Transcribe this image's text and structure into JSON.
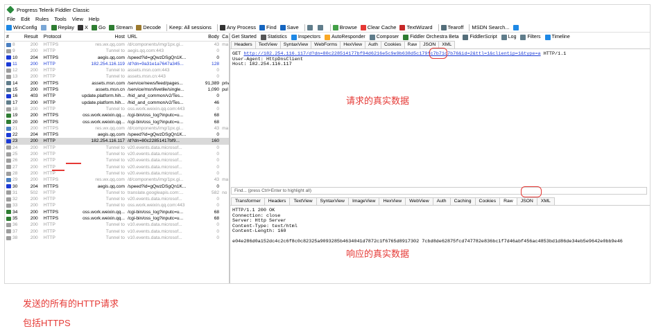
{
  "window": {
    "title": "Progress Telerik Fiddler Classic"
  },
  "menu": [
    "File",
    "Edit",
    "Rules",
    "Tools",
    "View",
    "Help"
  ],
  "toolbar": {
    "items": [
      {
        "label": "WinConfig",
        "icon": "windows-icon",
        "color": "#1e88e5"
      },
      {
        "label": "",
        "icon": "comment-icon",
        "color": "#7aa7d6"
      },
      {
        "label": "Replay",
        "icon": "replay-icon",
        "color": "#2e7d32"
      },
      {
        "label": "X",
        "icon": "remove-icon",
        "color": "#333333"
      },
      {
        "label": "Go",
        "icon": "go-icon",
        "color": "#2e7d32"
      },
      {
        "label": "Stream",
        "icon": "stream-icon",
        "color": "#2e7d32"
      },
      {
        "label": "Decode",
        "icon": "decode-icon",
        "color": "#9c7a2e"
      },
      {
        "label": "Keep: All sessions",
        "icon": "",
        "color": ""
      },
      {
        "label": "Any Process",
        "icon": "crosshair-icon",
        "color": "#333333"
      },
      {
        "label": "Find",
        "icon": "find-icon",
        "color": "#1565c0"
      },
      {
        "label": "Save",
        "icon": "save-icon",
        "color": "#1565c0"
      },
      {
        "label": "",
        "icon": "snapshot-icon",
        "color": "#607d8b"
      },
      {
        "label": "",
        "icon": "timer-icon",
        "color": "#607d8b"
      },
      {
        "label": "Browse",
        "icon": "browse-icon",
        "color": "#43a047"
      },
      {
        "label": "Clear Cache",
        "icon": "clear-cache-icon",
        "color": "#e53935"
      },
      {
        "label": "TextWizard",
        "icon": "textwizard-icon",
        "color": "#c62828"
      },
      {
        "label": "Tearoff",
        "icon": "tearoff-icon",
        "color": "#546e7a"
      },
      {
        "label": "MSDN Search...",
        "icon": "",
        "color": ""
      },
      {
        "label": "",
        "icon": "help-icon",
        "color": "#1e88e5"
      }
    ]
  },
  "sessions": {
    "columns": [
      "#",
      "Result",
      "Protocol",
      "Host",
      "URL",
      "Body",
      "Ca"
    ],
    "rows": [
      {
        "id": "8",
        "result": "200",
        "protocol": "HTTPS",
        "host": "res.wx.qq.com",
        "url": "/d/components/img/1px.gi...",
        "body": "43",
        "ca": "ma",
        "style": "grey",
        "icon": "image-icon",
        "iconColor": "#4a7fc1"
      },
      {
        "id": "9",
        "result": "200",
        "protocol": "HTTP",
        "host": "Tunnel to",
        "url": "aegis.qq.com:443",
        "body": "0",
        "ca": "",
        "style": "grey",
        "icon": "lock-icon",
        "iconColor": "#9e9e9e"
      },
      {
        "id": "10",
        "result": "204",
        "protocol": "HTTPS",
        "host": "aegis.qq.com",
        "url": "/speed?id=gQwzDSgQn1K...",
        "body": "0",
        "ca": "",
        "style": "normal",
        "icon": "info-icon",
        "iconColor": "#1a3ad6"
      },
      {
        "id": "11",
        "result": "200",
        "protocol": "HTTP",
        "host": "182.254.116.119",
        "url": "/d?dn=9a31e1a7647a345...",
        "body": "128",
        "ca": "",
        "style": "blue",
        "icon": "arrows-icon",
        "iconColor": "#1a3ad6"
      },
      {
        "id": "12",
        "result": "200",
        "protocol": "HTTP",
        "host": "Tunnel to",
        "url": "assets.msn.com:443",
        "body": "0",
        "ca": "",
        "style": "grey",
        "icon": "lock-icon",
        "iconColor": "#9e9e9e"
      },
      {
        "id": "13",
        "result": "200",
        "protocol": "HTTP",
        "host": "Tunnel to",
        "url": "assets.msn.cn:443",
        "body": "0",
        "ca": "",
        "style": "grey",
        "icon": "lock-icon",
        "iconColor": "#9e9e9e"
      },
      {
        "id": "14",
        "result": "200",
        "protocol": "HTTPS",
        "host": "assets.msn.com",
        "url": "/service/news/feed/pages...",
        "body": "91,389",
        "ca": "priv",
        "style": "normal",
        "icon": "json-icon",
        "iconColor": "#607d8b"
      },
      {
        "id": "15",
        "result": "200",
        "protocol": "HTTPS",
        "host": "assets.msn.cn",
        "url": "/service/msn/livetile/single...",
        "body": "1,090",
        "ca": "pul",
        "style": "normal",
        "icon": "doc-icon",
        "iconColor": "#607d8b"
      },
      {
        "id": "16",
        "result": "403",
        "protocol": "HTTP",
        "host": "update.platform.hih...",
        "url": "/hid_and_common/v2/Tes...",
        "body": "0",
        "ca": "",
        "style": "normal",
        "icon": "warning-icon",
        "iconColor": "#1a3ad6"
      },
      {
        "id": "17",
        "result": "200",
        "protocol": "HTTP",
        "host": "update.platform.hih...",
        "url": "/hid_and_common/v2/Tes...",
        "body": "46",
        "ca": "",
        "style": "normal",
        "icon": "json-icon",
        "iconColor": "#607d8b"
      },
      {
        "id": "18",
        "result": "200",
        "protocol": "HTTP",
        "host": "Tunnel to",
        "url": "oss.work.weixin.qq.com:443",
        "body": "0",
        "ca": "",
        "style": "grey",
        "icon": "lock-icon",
        "iconColor": "#9e9e9e"
      },
      {
        "id": "19",
        "result": "200",
        "protocol": "HTTPS",
        "host": "oss.work.weixin.qq...",
        "url": "/cgi-bin/oss_log?inputc=u...",
        "body": "68",
        "ca": "",
        "style": "normal",
        "icon": "script-icon",
        "iconColor": "#2e7d32"
      },
      {
        "id": "20",
        "result": "200",
        "protocol": "HTTPS",
        "host": "oss.work.weixin.qq...",
        "url": "/cgi-bin/oss_log?inputc=u...",
        "body": "68",
        "ca": "",
        "style": "normal",
        "icon": "script-icon",
        "iconColor": "#2e7d32"
      },
      {
        "id": "21",
        "result": "200",
        "protocol": "HTTPS",
        "host": "res.wx.qq.com",
        "url": "/d/components/img/1px.gi...",
        "body": "43",
        "ca": "ma",
        "style": "grey",
        "icon": "image-icon",
        "iconColor": "#4a7fc1"
      },
      {
        "id": "22",
        "result": "204",
        "protocol": "HTTPS",
        "host": "aegis.qq.com",
        "url": "/speed?id=gQwzDSgQn1K...",
        "body": "0",
        "ca": "",
        "style": "normal",
        "icon": "info-icon",
        "iconColor": "#1a3ad6"
      },
      {
        "id": "23",
        "result": "200",
        "protocol": "HTTP",
        "host": "182.254.116.117",
        "url": "/d?dn=80c22851417bf9...",
        "body": "160",
        "ca": "",
        "style": "sel",
        "icon": "arrows-icon",
        "iconColor": "#1a3ad6"
      },
      {
        "id": "24",
        "result": "200",
        "protocol": "HTTP",
        "host": "Tunnel to",
        "url": "v20.events.data.microsof...",
        "body": "0",
        "ca": "",
        "style": "grey",
        "icon": "lock-icon",
        "iconColor": "#9e9e9e"
      },
      {
        "id": "25",
        "result": "200",
        "protocol": "HTTP",
        "host": "Tunnel to",
        "url": "v20.events.data.microsof...",
        "body": "0",
        "ca": "",
        "style": "grey",
        "icon": "lock-icon",
        "iconColor": "#9e9e9e"
      },
      {
        "id": "26",
        "result": "200",
        "protocol": "HTTP",
        "host": "Tunnel to",
        "url": "v20.events.data.microsof...",
        "body": "0",
        "ca": "",
        "style": "grey",
        "icon": "lock-icon",
        "iconColor": "#9e9e9e"
      },
      {
        "id": "27",
        "result": "200",
        "protocol": "HTTP",
        "host": "Tunnel to",
        "url": "v20.events.data.microsof...",
        "body": "0",
        "ca": "",
        "style": "grey",
        "icon": "lock-icon",
        "iconColor": "#9e9e9e"
      },
      {
        "id": "28",
        "result": "200",
        "protocol": "HTTP",
        "host": "Tunnel to",
        "url": "v20.events.data.microsof...",
        "body": "0",
        "ca": "",
        "style": "grey",
        "icon": "lock-icon",
        "iconColor": "#9e9e9e"
      },
      {
        "id": "29",
        "result": "200",
        "protocol": "HTTPS",
        "host": "res.wx.qq.com",
        "url": "/d/components/img/1px.gi...",
        "body": "43",
        "ca": "ma",
        "style": "grey",
        "icon": "image-icon",
        "iconColor": "#4a7fc1"
      },
      {
        "id": "30",
        "result": "204",
        "protocol": "HTTPS",
        "host": "aegis.qq.com",
        "url": "/speed?id=gQwzDSgQn1K...",
        "body": "0",
        "ca": "",
        "style": "normal",
        "icon": "info-icon",
        "iconColor": "#1a3ad6"
      },
      {
        "id": "31",
        "result": "502",
        "protocol": "HTTP",
        "host": "Tunnel to",
        "url": "translate.googleapis.com:...",
        "body": "582",
        "ca": "no",
        "style": "grey",
        "icon": "lock-icon",
        "iconColor": "#9e9e9e"
      },
      {
        "id": "32",
        "result": "200",
        "protocol": "HTTP",
        "host": "Tunnel to",
        "url": "v20.events.data.microsof...",
        "body": "0",
        "ca": "",
        "style": "grey",
        "icon": "lock-icon",
        "iconColor": "#9e9e9e"
      },
      {
        "id": "33",
        "result": "200",
        "protocol": "HTTP",
        "host": "Tunnel to",
        "url": "oss.work.weixin.qq.com:443",
        "body": "0",
        "ca": "",
        "style": "grey",
        "icon": "lock-icon",
        "iconColor": "#9e9e9e"
      },
      {
        "id": "34",
        "result": "200",
        "protocol": "HTTPS",
        "host": "oss.work.weixin.qq...",
        "url": "/cgi-bin/oss_log?inputc=u...",
        "body": "68",
        "ca": "",
        "style": "normal",
        "icon": "script-icon",
        "iconColor": "#2e7d32"
      },
      {
        "id": "35",
        "result": "200",
        "protocol": "HTTPS",
        "host": "oss.work.weixin.qq...",
        "url": "/cgi-bin/oss_log?inputc=u...",
        "body": "68",
        "ca": "",
        "style": "normal",
        "icon": "script-icon",
        "iconColor": "#2e7d32"
      },
      {
        "id": "36",
        "result": "200",
        "protocol": "HTTP",
        "host": "Tunnel to",
        "url": "v10.events.data.microsof...",
        "body": "0",
        "ca": "",
        "style": "grey",
        "icon": "lock-icon",
        "iconColor": "#9e9e9e"
      },
      {
        "id": "37",
        "result": "200",
        "protocol": "HTTP",
        "host": "Tunnel to",
        "url": "v10.events.data.microsof...",
        "body": "0",
        "ca": "",
        "style": "grey",
        "icon": "lock-icon",
        "iconColor": "#9e9e9e"
      },
      {
        "id": "38",
        "result": "200",
        "protocol": "HTTP",
        "host": "Tunnel to",
        "url": "v10.events.data.microsof...",
        "body": "0",
        "ca": "",
        "style": "grey",
        "icon": "lock-icon",
        "iconColor": "#9e9e9e"
      }
    ]
  },
  "topTabs": [
    {
      "label": "Get Started",
      "icon": "",
      "color": ""
    },
    {
      "label": "Statistics",
      "icon": "statistics-icon",
      "color": "#555555"
    },
    {
      "label": "Inspectors",
      "icon": "inspectors-icon",
      "color": "#1e88e5"
    },
    {
      "label": "AutoResponder",
      "icon": "autoresponder-icon",
      "color": "#f9a825"
    },
    {
      "label": "Composer",
      "icon": "composer-icon",
      "color": "#607d8b"
    },
    {
      "label": "Fiddler Orchestra Beta",
      "icon": "orchestra-icon",
      "color": "#2e7d32"
    },
    {
      "label": "FiddlerScript",
      "icon": "fiddlerscript-icon",
      "color": "#546e7a"
    },
    {
      "label": "Log",
      "icon": "log-icon",
      "color": "#607d8b"
    },
    {
      "label": "Filters",
      "icon": "filters-icon",
      "color": "#607d8b"
    },
    {
      "label": "Timeline",
      "icon": "timeline-icon",
      "color": "#1e88e5"
    }
  ],
  "requestTabs": [
    "Headers",
    "TextView",
    "SyntaxView",
    "WebForms",
    "HexView",
    "Auth",
    "Cookies",
    "Raw",
    "JSON",
    "XML"
  ],
  "request": {
    "method": "GET",
    "url": "http://182.254.116.117/d?dn=80c228514177bf94d6216e5c9e9b638d5c179fc7b71c7b76&id=2&ttl=1&clientip=1&type=a",
    "version": "HTTP/1.1",
    "line2": "User-Agent: HttpDnsClient",
    "line3": "Host: 182.254.116.117"
  },
  "findbar": {
    "placeholder": "Find... (press Ctrl+Enter to highlight all)"
  },
  "responseTabs": [
    "Transformer",
    "Headers",
    "TextView",
    "SyntaxView",
    "ImageView",
    "HexView",
    "WebView",
    "Auth",
    "Caching",
    "Cookies",
    "Raw",
    "JSON",
    "XML"
  ],
  "response": {
    "raw": "HTTP/1.1 200 OK\nConnection: close\nServer: Http Server\nContent-Type: text/html\nContent-Length: 160\n\ne04e286d0a152dc4c2c6f8c0c82325a9093285b4634041d7872c1f6765d8917302 7cbd8de62875fcd747782e836bc1f7d46abf456ac4853bd1d86de34eb5e9642e0bb9e46"
  },
  "annotations": {
    "request_label": "请求的真实数据",
    "response_label": "响应的真实数据",
    "caption_line1": "发送的所有的HTTP请求",
    "caption_line2": "包括HTTPS",
    "color": "#e53935"
  }
}
